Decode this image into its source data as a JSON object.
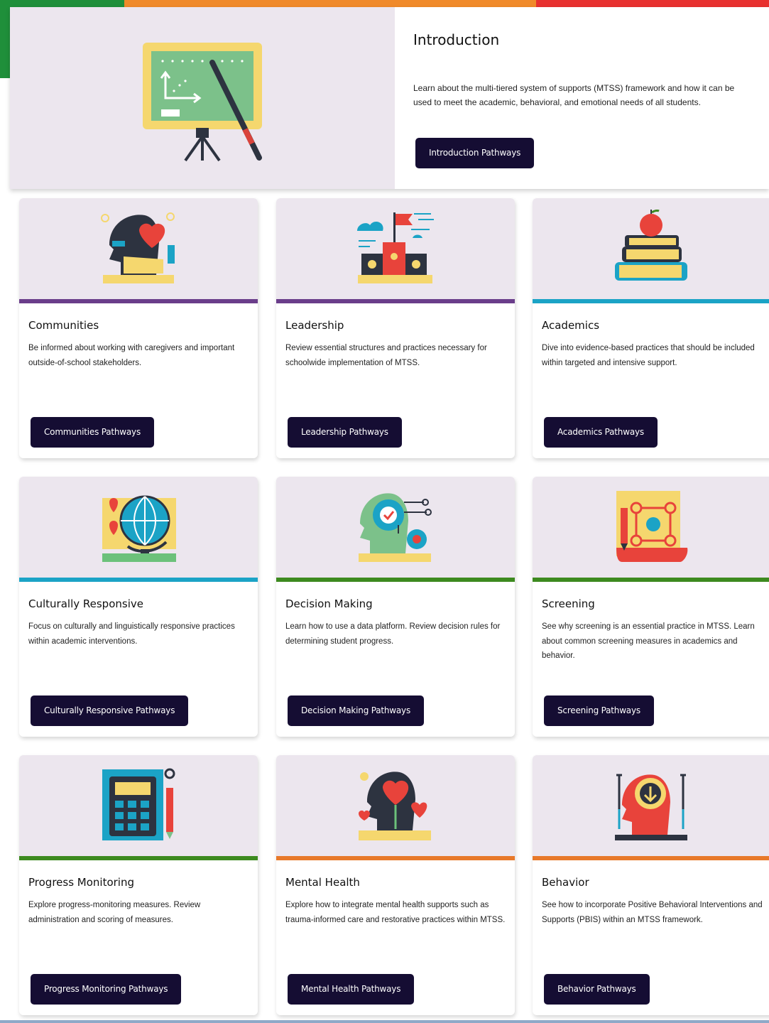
{
  "colors": {
    "top_green": "#1f8f3a",
    "top_orange": "#f08a2a",
    "top_red": "#e8312f",
    "button_bg": "#150d33",
    "card_image_bg": "#ece6ee",
    "stripe_purple": "#6a3d8a",
    "stripe_teal": "#1ba3c6",
    "stripe_green": "#3d8a1f",
    "stripe_orange": "#e8792a"
  },
  "intro": {
    "title": "Introduction",
    "description": "Learn about the multi-tiered system of supports (MTSS) framework and how it can be used to meet the academic, behavioral, and emotional needs of all students.",
    "button": "Introduction Pathways",
    "icon": "chalkboard-icon"
  },
  "cards": [
    {
      "title": "Communities",
      "description": "Be informed about working with caregivers and important outside-of-school stakeholders.",
      "button": "Communities Pathways",
      "icon": "head-heart-icon",
      "stripe": "purple"
    },
    {
      "title": "Leadership",
      "description": "Review essential structures and practices necessary for schoolwide implementation of MTSS.",
      "button": "Leadership Pathways",
      "icon": "podium-flag-icon",
      "stripe": "purple"
    },
    {
      "title": "Academics",
      "description": "Dive into evidence-based practices that should be included within targeted and intensive support.",
      "button": "Academics Pathways",
      "icon": "books-apple-icon",
      "stripe": "teal"
    },
    {
      "title": "Culturally Responsive",
      "description": "Focus on culturally and linguistically responsive practices within academic interventions.",
      "button": "Culturally Responsive Pathways",
      "icon": "globe-icon",
      "stripe": "teal"
    },
    {
      "title": "Decision Making",
      "description": "Learn how to use a data platform. Review decision rules for determining student progress.",
      "button": "Decision Making Pathways",
      "icon": "head-gears-icon",
      "stripe": "green"
    },
    {
      "title": "Screening",
      "description": "See why screening is an essential practice in MTSS. Learn about common screening measures in academics and behavior.",
      "button": "Screening Pathways",
      "icon": "blueprint-icon",
      "stripe": "green"
    },
    {
      "title": "Progress Monitoring",
      "description": "Explore progress-monitoring measures. Review administration and scoring of measures.",
      "button": "Progress Monitoring Pathways",
      "icon": "calculator-icon",
      "stripe": "green"
    },
    {
      "title": "Mental Health",
      "description": "Explore how to integrate mental health supports such as trauma-informed care and restorative practices within MTSS.",
      "button": "Mental Health Pathways",
      "icon": "head-hearts-icon",
      "stripe": "orange"
    },
    {
      "title": "Behavior",
      "description": "See how to incorporate Positive Behavioral Interventions and Supports (PBIS) within an MTSS framework.",
      "button": "Behavior Pathways",
      "icon": "head-download-icon",
      "stripe": "orange"
    }
  ]
}
